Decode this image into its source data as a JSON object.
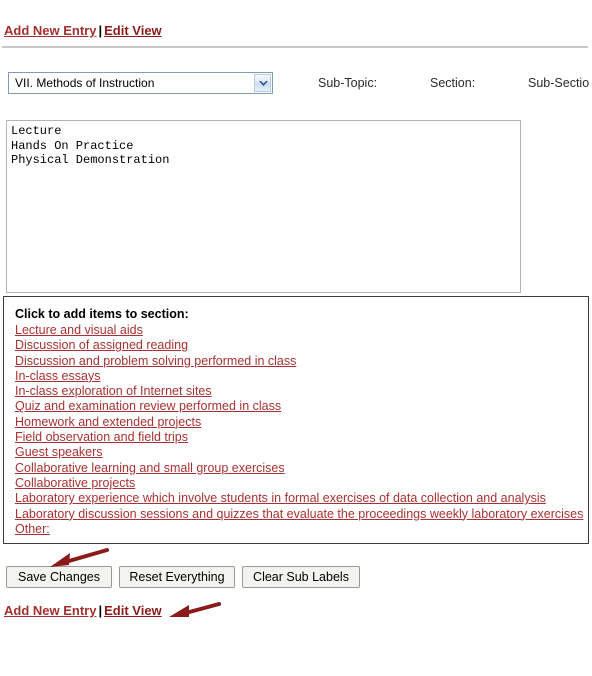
{
  "top_nav": {
    "add_new_entry": "Add New Entry",
    "separator": "|",
    "edit_view": "Edit View"
  },
  "selector": {
    "selected_option": "VII. Methods of Instruction",
    "dropdown_icon": "chevron-down-icon",
    "labels": {
      "sub_topic": "Sub-Topic:",
      "section": "Section:",
      "sub_section": "Sub-Sectio"
    }
  },
  "editor": {
    "value": "Lecture\nHands On Practice\nPhysical Demonstration",
    "placeholder": ""
  },
  "picker_panel": {
    "title": "Click to add items to section:",
    "items": [
      "Lecture and visual aids",
      "Discussion of assigned reading",
      "Discussion and problem solving performed in class",
      "In-class essays",
      "In-class exploration of Internet sites",
      "Quiz and examination review performed in class",
      "Homework and extended projects",
      "Field observation and field trips",
      "Guest speakers",
      "Collaborative learning and small group exercises",
      "Collaborative projects",
      "Laboratory experience which involve students in formal exercises of data collection and analysis",
      "Laboratory discussion sessions and quizzes that evaluate the proceedings weekly laboratory exercises",
      "Other:"
    ]
  },
  "buttons": {
    "save": "Save Changes",
    "reset": "Reset Everything",
    "clear": "Clear Sub Labels"
  },
  "bottom_nav": {
    "add_new_entry": "Add New Entry",
    "separator": "|",
    "edit_view": "Edit View"
  },
  "annotations": {
    "arrow_color": "#8b1a1a",
    "arrow_save_target": "Save Changes",
    "arrow_edit_view_target": "Edit View"
  },
  "colors": {
    "link": "#a83232",
    "link_strong": "#8c1b1b",
    "panel_border": "#3b3b3b",
    "rule": "#c8c8c8",
    "select_border": "#7f9db9"
  }
}
